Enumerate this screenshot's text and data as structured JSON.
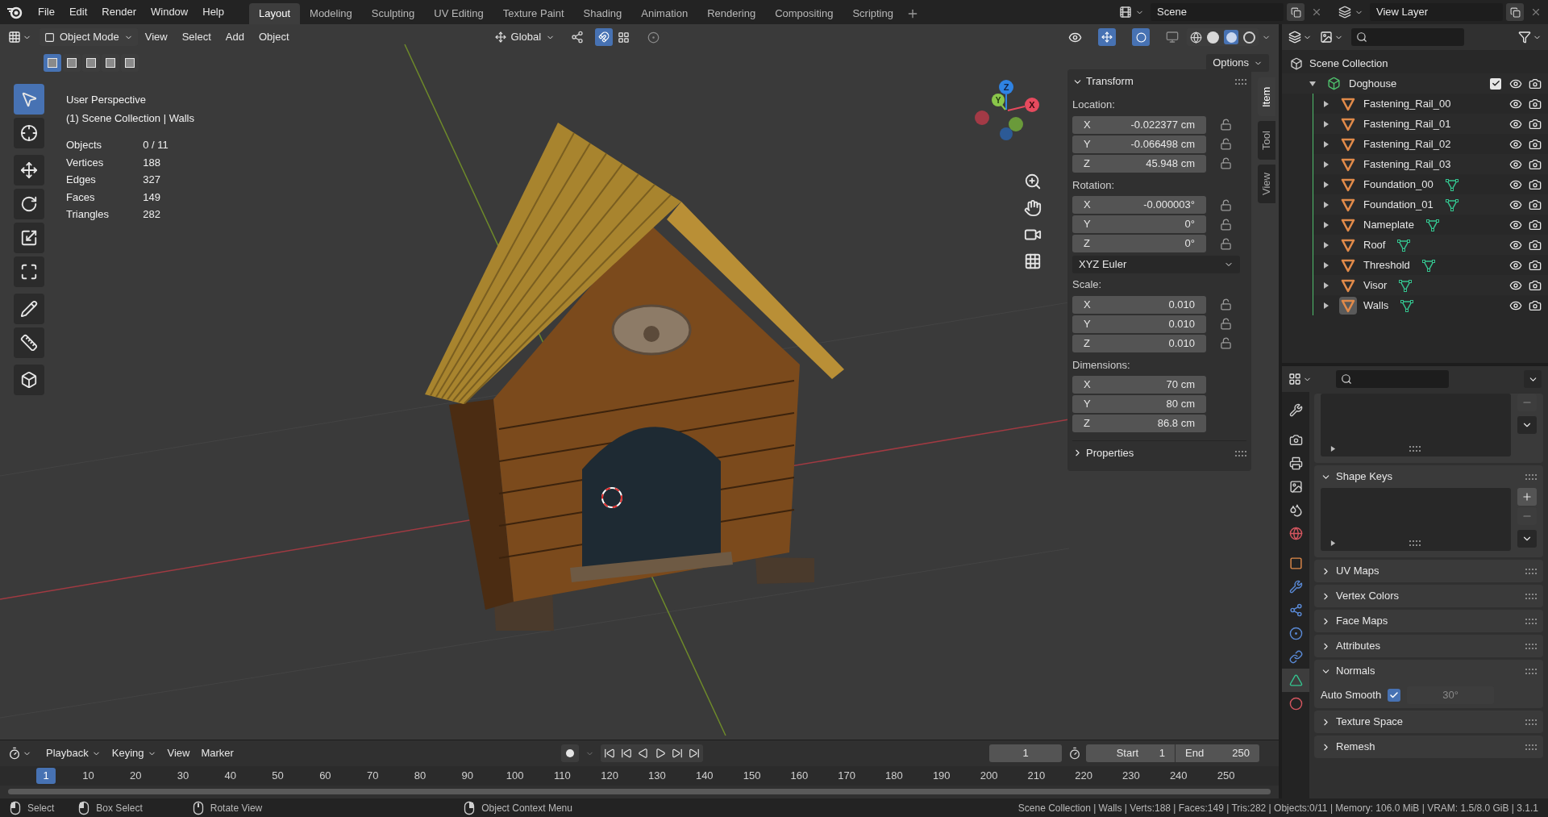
{
  "topbar": {
    "menus": [
      "File",
      "Edit",
      "Render",
      "Window",
      "Help"
    ],
    "workspaces": [
      {
        "label": "Layout",
        "selected": true
      },
      {
        "label": "Modeling",
        "selected": false
      },
      {
        "label": "Sculpting",
        "selected": false
      },
      {
        "label": "UV Editing",
        "selected": false
      },
      {
        "label": "Texture Paint",
        "selected": false
      },
      {
        "label": "Shading",
        "selected": false
      },
      {
        "label": "Animation",
        "selected": false
      },
      {
        "label": "Rendering",
        "selected": false
      },
      {
        "label": "Compositing",
        "selected": false
      },
      {
        "label": "Scripting",
        "selected": false
      }
    ],
    "scene": "Scene",
    "view_layer": "View Layer"
  },
  "viewport": {
    "mode": "Object Mode",
    "menus": [
      "View",
      "Select",
      "Add",
      "Object"
    ],
    "orientation": "Global",
    "options": "Options",
    "select_modes": [
      {
        "selected": true
      },
      {
        "selected": false
      },
      {
        "selected": false
      },
      {
        "selected": false
      },
      {
        "selected": false
      }
    ],
    "tools": [
      {
        "kind": "select",
        "selected": true
      },
      {
        "kind": "cursor",
        "selected": false
      },
      {
        "kind": "move",
        "selected": false
      },
      {
        "kind": "rotate",
        "selected": false
      },
      {
        "kind": "scale",
        "selected": false
      },
      {
        "kind": "transform",
        "selected": false
      },
      {
        "kind": "annotate",
        "selected": false
      },
      {
        "kind": "measure",
        "selected": false
      },
      {
        "kind": "add_cube",
        "selected": false
      }
    ],
    "overlay": {
      "title": "User Perspective",
      "context": "(1) Scene Collection | Walls",
      "stats": [
        {
          "label": "Objects",
          "value": "0 / 11"
        },
        {
          "label": "Vertices",
          "value": "188"
        },
        {
          "label": "Edges",
          "value": "327"
        },
        {
          "label": "Faces",
          "value": "149"
        },
        {
          "label": "Triangles",
          "value": "282"
        }
      ]
    },
    "gizmo": {
      "x": "X",
      "y": "Y",
      "z": "Z"
    }
  },
  "sidebar": {
    "tabs": [
      {
        "label": "Item",
        "selected": true
      },
      {
        "label": "Tool",
        "selected": false
      },
      {
        "label": "View",
        "selected": false
      }
    ],
    "transform": {
      "title": "Transform",
      "expanded": true,
      "groups": [
        {
          "label": "Location:",
          "fields": [
            {
              "axis": "X",
              "value": "-0.022377 cm",
              "locked": false
            },
            {
              "axis": "Y",
              "value": "-0.066498 cm",
              "locked": false
            },
            {
              "axis": "Z",
              "value": "45.948 cm",
              "locked": false
            }
          ]
        },
        {
          "label": "Rotation:",
          "fields": [
            {
              "axis": "X",
              "value": "-0.000003°",
              "locked": false
            },
            {
              "axis": "Y",
              "value": "0°",
              "locked": false
            },
            {
              "axis": "Z",
              "value": "0°",
              "locked": false
            }
          ],
          "mode": "XYZ Euler"
        },
        {
          "label": "Scale:",
          "fields": [
            {
              "axis": "X",
              "value": "0.010",
              "locked": false
            },
            {
              "axis": "Y",
              "value": "0.010",
              "locked": false
            },
            {
              "axis": "Z",
              "value": "0.010",
              "locked": false
            }
          ]
        },
        {
          "label": "Dimensions:",
          "fields": [
            {
              "axis": "X",
              "value": "70 cm"
            },
            {
              "axis": "Y",
              "value": "80 cm"
            },
            {
              "axis": "Z",
              "value": "86.8 cm"
            }
          ]
        }
      ]
    },
    "properties": {
      "title": "Properties",
      "expanded": false
    }
  },
  "outliner": {
    "root": "Scene Collection",
    "collections": [
      {
        "name": "Doghouse",
        "expanded": true,
        "checked": true,
        "children": [
          {
            "name": "Fastening_Rail_00",
            "mesh_data": false,
            "active": false
          },
          {
            "name": "Fastening_Rail_01",
            "mesh_data": false,
            "active": false
          },
          {
            "name": "Fastening_Rail_02",
            "mesh_data": false,
            "active": false
          },
          {
            "name": "Fastening_Rail_03",
            "mesh_data": false,
            "active": false
          },
          {
            "name": "Foundation_00",
            "mesh_data": true,
            "active": false
          },
          {
            "name": "Foundation_01",
            "mesh_data": true,
            "active": false
          },
          {
            "name": "Nameplate",
            "mesh_data": true,
            "active": false
          },
          {
            "name": "Roof",
            "mesh_data": true,
            "active": false
          },
          {
            "name": "Threshold",
            "mesh_data": true,
            "active": false
          },
          {
            "name": "Visor",
            "mesh_data": true,
            "active": false
          },
          {
            "name": "Walls",
            "mesh_data": true,
            "active": true
          }
        ]
      }
    ]
  },
  "properties": {
    "tabs": [
      {
        "kind": "tool",
        "selected": false
      },
      {
        "kind": "render",
        "selected": false
      },
      {
        "kind": "output",
        "selected": false
      },
      {
        "kind": "view_layer",
        "selected": false
      },
      {
        "kind": "scene",
        "selected": false
      },
      {
        "kind": "world",
        "selected": false
      },
      {
        "kind": "object",
        "selected": false
      },
      {
        "kind": "modifiers",
        "selected": false
      },
      {
        "kind": "particles",
        "selected": false
      },
      {
        "kind": "physics",
        "selected": false
      },
      {
        "kind": "constraints",
        "selected": false
      },
      {
        "kind": "data",
        "selected": true
      },
      {
        "kind": "material",
        "selected": false
      }
    ],
    "panels": [
      {
        "kind": "list",
        "expanded": true
      },
      {
        "kind": "list",
        "title": "Shape Keys",
        "expanded": true
      },
      {
        "kind": "section",
        "title": "UV Maps",
        "expanded": false
      },
      {
        "kind": "section",
        "title": "Vertex Colors",
        "expanded": false
      },
      {
        "kind": "section",
        "title": "Face Maps",
        "expanded": false
      },
      {
        "kind": "section",
        "title": "Attributes",
        "expanded": false
      },
      {
        "kind": "normals",
        "title": "Normals",
        "expanded": true,
        "auto_smooth": {
          "label": "Auto Smooth",
          "checked": true,
          "angle": "30°"
        }
      },
      {
        "kind": "section",
        "title": "Texture Space",
        "expanded": false
      },
      {
        "kind": "section",
        "title": "Remesh",
        "expanded": false
      }
    ]
  },
  "timeline": {
    "menus": [
      {
        "label": "Playback",
        "dropdown": true
      },
      {
        "label": "Keying",
        "dropdown": true
      },
      {
        "label": "View",
        "dropdown": false
      },
      {
        "label": "Marker",
        "dropdown": false
      }
    ],
    "current_frame": "1",
    "start_label": "Start",
    "start": "1",
    "end_label": "End",
    "end": "250",
    "ruler": [
      {
        "label": "1",
        "selected": true
      },
      {
        "label": "10",
        "selected": false
      },
      {
        "label": "20",
        "selected": false
      },
      {
        "label": "30",
        "selected": false
      },
      {
        "label": "40",
        "selected": false
      },
      {
        "label": "50",
        "selected": false
      },
      {
        "label": "60",
        "selected": false
      },
      {
        "label": "70",
        "selected": false
      },
      {
        "label": "80",
        "selected": false
      },
      {
        "label": "90",
        "selected": false
      },
      {
        "label": "100",
        "selected": false
      },
      {
        "label": "110",
        "selected": false
      },
      {
        "label": "120",
        "selected": false
      },
      {
        "label": "130",
        "selected": false
      },
      {
        "label": "140",
        "selected": false
      },
      {
        "label": "150",
        "selected": false
      },
      {
        "label": "160",
        "selected": false
      },
      {
        "label": "170",
        "selected": false
      },
      {
        "label": "180",
        "selected": false
      },
      {
        "label": "190",
        "selected": false
      },
      {
        "label": "200",
        "selected": false
      },
      {
        "label": "210",
        "selected": false
      },
      {
        "label": "220",
        "selected": false
      },
      {
        "label": "230",
        "selected": false
      },
      {
        "label": "240",
        "selected": false
      },
      {
        "label": "250",
        "selected": false
      }
    ]
  },
  "status": {
    "hints": [
      {
        "kind": "left",
        "label": "Select"
      },
      {
        "kind": "drag",
        "label": "Box Select"
      },
      {
        "kind": "middle",
        "label": "Rotate View"
      },
      {
        "kind": "right",
        "label": "Object Context Menu"
      }
    ],
    "info": "Scene Collection | Walls | Verts:188 | Faces:149 | Tris:282 | Objects:0/11 | Memory: 106.0 MiB | VRAM: 1.5/8.0 GiB | 3.1.1"
  }
}
